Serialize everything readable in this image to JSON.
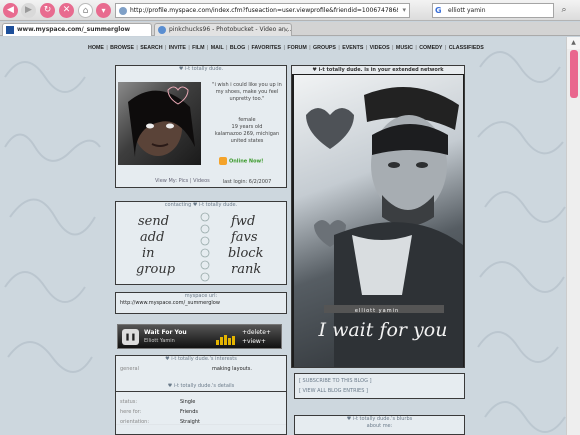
{
  "browser": {
    "url": "http://profile.myspace.com/index.cfm?fuseaction=user.viewprofile&friendid=100674786&MyToken=c",
    "search_value": "elliott yamin",
    "search_engine_glyph": "G",
    "tabs": [
      {
        "label": "www.myspace.com/_summerglow"
      },
      {
        "label": "pinkchucks96 - Photobucket - Video an..."
      }
    ],
    "close_glyph": "×"
  },
  "nav": {
    "items": [
      "HOME",
      "BROWSE",
      "SEARCH",
      "INVITE",
      "FILM",
      "MAIL",
      "BLOG",
      "FAVORITES",
      "FORUM",
      "GROUPS",
      "EVENTS",
      "VIDEOS",
      "MUSIC",
      "COMEDY",
      "CLASSIFIEDS"
    ]
  },
  "profile": {
    "name_header": "♥ i-t totally dude.",
    "quote": "\"i wish i could like you up in my shoes, make you feel unpretty too.\"",
    "gender": "female",
    "age": "19 years old",
    "location": "kalamazoo 269, michigan",
    "country": "united states",
    "online": "Online Now!",
    "last_login": "last login: 6/2/2007",
    "view_pics": "View My: Pics | Videos"
  },
  "contacting": {
    "header": "contacting ♥ i-t totally dude.",
    "left": [
      "send",
      "add",
      "in",
      "group"
    ],
    "right": [
      "fwd",
      "favs",
      "block",
      "rank"
    ]
  },
  "url_box": {
    "header": "myspace url:",
    "value": "http://www.myspace.com/_summerglow"
  },
  "player": {
    "song": "Wait For You",
    "artist": "Elliott Yamin",
    "delete": "+delete+",
    "view": "+view+",
    "level": 0.7
  },
  "interests": {
    "header": "♥ i-t totally dude.'s interests",
    "rows": [
      {
        "k": "general",
        "v": "making layouts."
      }
    ]
  },
  "details": {
    "header": "♥ i-t totally dude.'s details",
    "rows": [
      {
        "k": "status:",
        "v": "Single"
      },
      {
        "k": "here for:",
        "v": "Friends"
      },
      {
        "k": "orientation:",
        "v": "Straight"
      }
    ]
  },
  "extended": {
    "header": "♥ i-t totally dude. is in your extended network",
    "image_caption": "I wait for you",
    "image_small": "elliott yamin"
  },
  "blog": {
    "links": [
      "[ SUBSCRIBE TO THIS BLOG ]",
      "[ VIEW ALL BLOG ENTRIES ]"
    ]
  },
  "blurbs": {
    "header": "♥ i-t totally dude.'s blurbs",
    "about": "about me:",
    "line1": "hi, my name is nina,",
    "line2": "and my lipgloss is so poppin'"
  }
}
